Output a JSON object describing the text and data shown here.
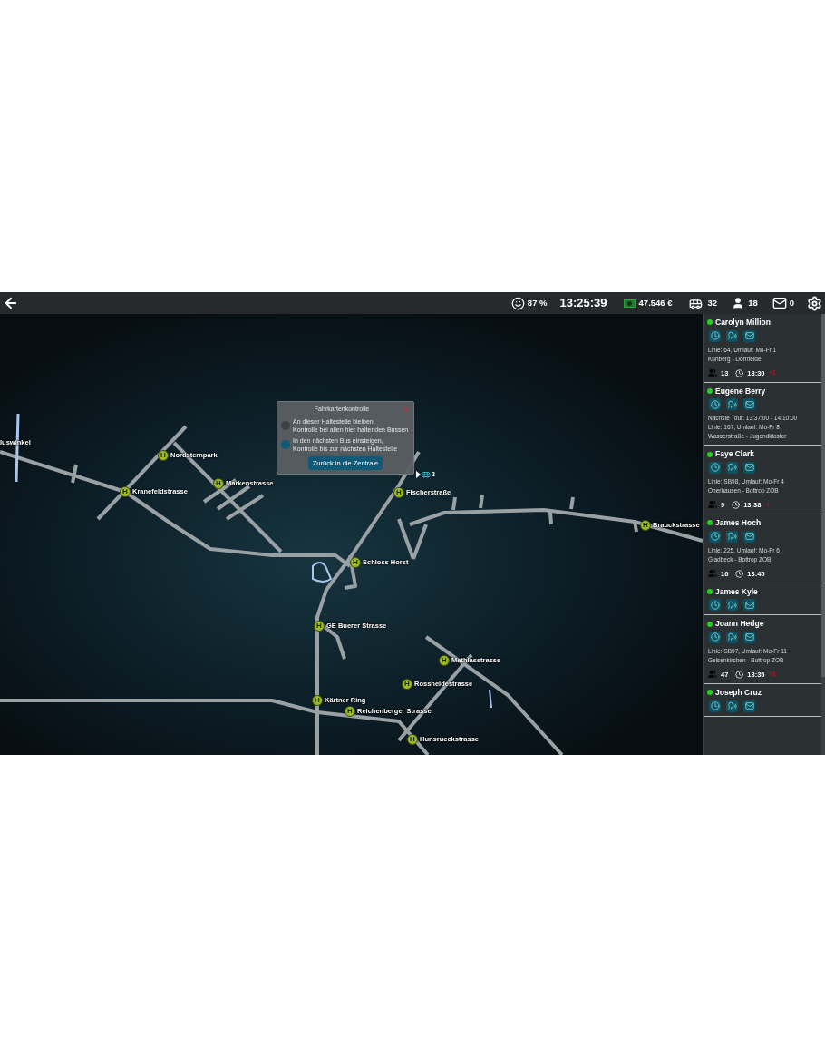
{
  "top_bar": {
    "satisfaction": "87 %",
    "clock": "13:25:39",
    "money": "47.546 €",
    "buses": "32",
    "drivers": "18",
    "messages": "0"
  },
  "map": {
    "stops": [
      {
        "name": "luswinkel",
        "kind": "label"
      },
      {
        "name": "Nordsternpark",
        "kind": "stop",
        "symbol": "H"
      },
      {
        "name": "Kranefeldstrasse",
        "kind": "stop",
        "symbol": "H"
      },
      {
        "name": "Markenstrasse",
        "kind": "stop",
        "symbol": "H"
      },
      {
        "name": "Fischerstraße",
        "kind": "stop",
        "symbol": "H"
      },
      {
        "name": "Brauckstrasse",
        "kind": "stop",
        "symbol": "H"
      },
      {
        "name": "Schloss Horst",
        "kind": "stop",
        "symbol": "H"
      },
      {
        "name": "GE Buerer Strasse",
        "kind": "stop",
        "symbol": "H"
      },
      {
        "name": "Mathiasstrasse",
        "kind": "stop",
        "symbol": "H"
      },
      {
        "name": "Rossheidestrasse",
        "kind": "stop",
        "symbol": "H"
      },
      {
        "name": "Kärtner Ring",
        "kind": "stop",
        "symbol": "H"
      },
      {
        "name": "Reichenberger Strasse",
        "kind": "stop",
        "symbol": "H"
      },
      {
        "name": "Hunsrueckstrasse",
        "kind": "stop",
        "symbol": "H"
      }
    ],
    "bus_marker": {
      "count": "2"
    }
  },
  "dialog": {
    "title": "Fahrkartenkontrolle",
    "options": [
      {
        "lines": [
          "An dieser Haltestelle bleiben,",
          "Kontrolle bei allen hier haltenden Bussen"
        ],
        "selected": false
      },
      {
        "lines": [
          "In den nächsten Bus einsteigen,",
          "Kontrolle bis zur nächsten Haltestelle"
        ],
        "selected": true
      }
    ],
    "button": "Zurück in die Zentrale"
  },
  "drivers": [
    {
      "name": "Carolyn Million",
      "lines": [
        "Linie: 64, Umlauf: Mo-Fr 1",
        "Kuhberg - Dorfheide"
      ],
      "passengers": "13",
      "time": "13:30",
      "delay": "+3"
    },
    {
      "name": "Eugene Berry",
      "lines": [
        "Nächste Tour: 13:37:00 - 14:10:00",
        "Linie: 167, Umlauf: Mo-Fr 8",
        "Wasserstraße - Jugendkloster"
      ]
    },
    {
      "name": "Faye Clark",
      "lines": [
        "Linie: SB98, Umlauf: Mo-Fr 4",
        "Oberhausen - Bottrop ZOB"
      ],
      "passengers": "9",
      "time": "13:38",
      "delay": "-1"
    },
    {
      "name": "James Hoch",
      "lines": [
        "Linie: 225, Umlauf: Mo-Fr 6",
        "Gladbeck - Bottrop ZOB"
      ],
      "passengers": "16",
      "time": "13:45"
    },
    {
      "name": "James Kyle"
    },
    {
      "name": "Joann Hedge",
      "lines": [
        "Linie: SB97, Umlauf: Mo-Fr 11",
        "Gelsenkirchen - Bottrop ZOB"
      ],
      "passengers": "47",
      "time": "13:35",
      "delay": "+8"
    },
    {
      "name": "Joseph Cruz"
    }
  ]
}
